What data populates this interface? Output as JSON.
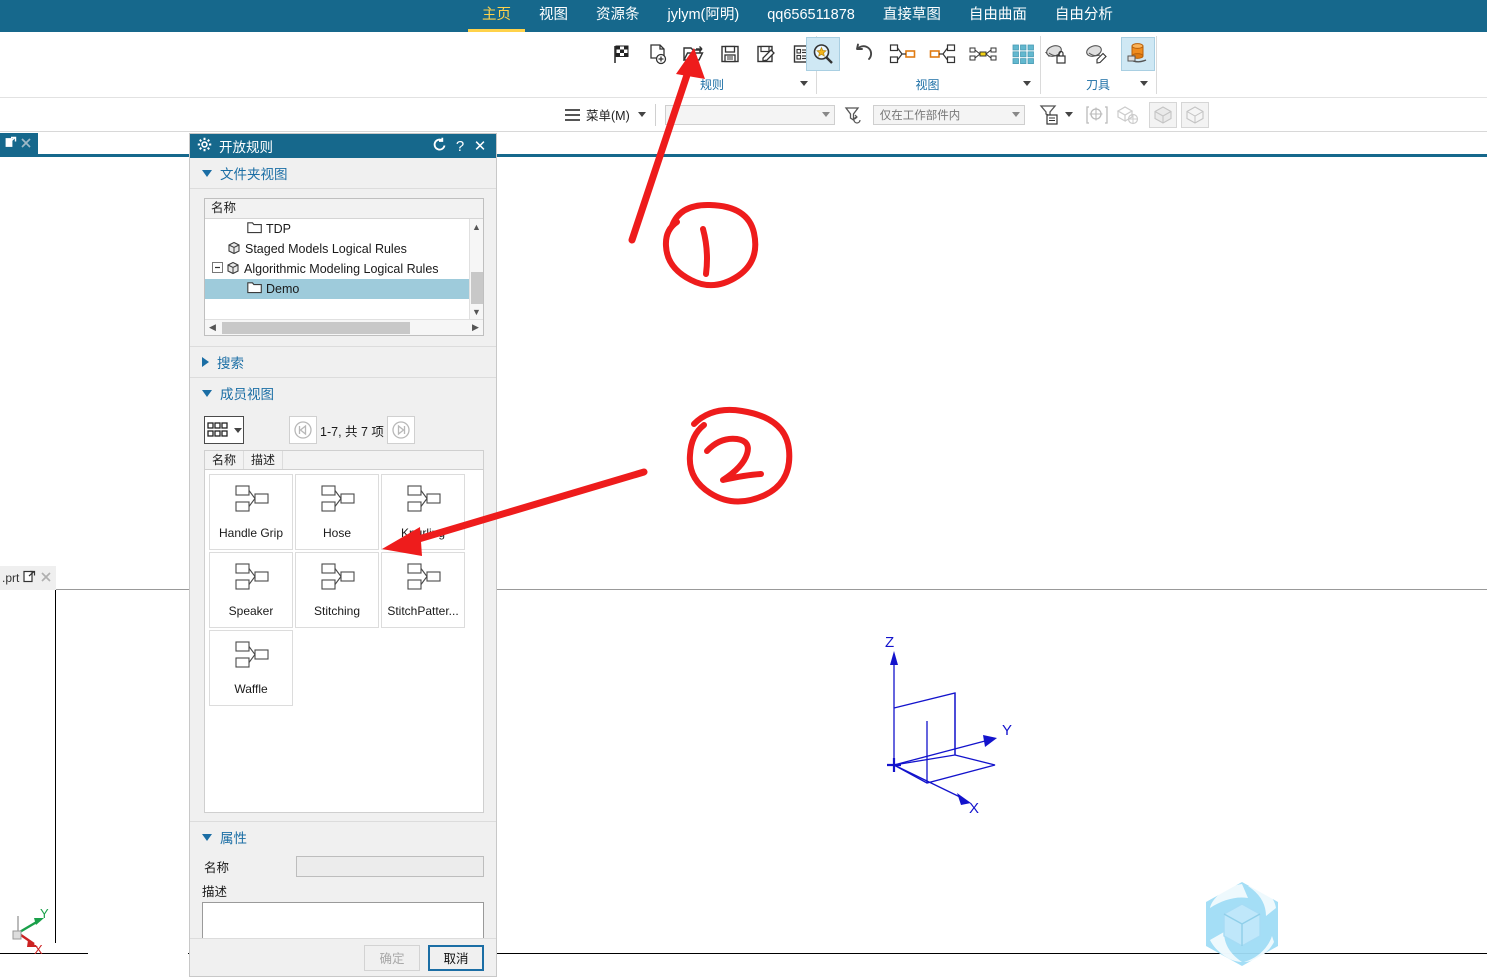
{
  "ribbon": {
    "tabs": [
      {
        "label": "主页",
        "active": true
      },
      {
        "label": "视图",
        "active": false
      },
      {
        "label": "资源条",
        "active": false
      },
      {
        "label": "jylym(阿明)",
        "active": false
      },
      {
        "label": "qq656511878",
        "active": false
      },
      {
        "label": "直接草图",
        "active": false
      },
      {
        "label": "自由曲面",
        "active": false
      },
      {
        "label": "自由分析",
        "active": false
      }
    ],
    "groups": [
      {
        "name": "规则",
        "icons": [
          "checkered-flag-icon",
          "new-document-icon",
          "open-folder-icon",
          "save-icon",
          "save-as-icon",
          "checklist-icon"
        ]
      },
      {
        "name": "视图",
        "icons": [
          "zoom-magnifier-icon",
          "undo-icon",
          "expand-node-icon",
          "collapse-node-icon",
          "link-nodes-icon",
          "grid-view-icon"
        ]
      },
      {
        "name": "刀具",
        "icons": [
          "tool-lock-icon",
          "tool-edit-icon",
          "tool-cylinder-icon"
        ]
      }
    ]
  },
  "toolbar2": {
    "menu_label": "菜单(M)",
    "combo1_value": "",
    "combo2_value": "仅在工作部件内",
    "icons": [
      "filter-undo-icon",
      "filter-list-icon",
      "selection-point-icon",
      "selection-body-icon",
      "shaded-view-icon",
      "wireframe-view-icon"
    ]
  },
  "dock": {
    "top_tab_icons": [
      "detach-icon",
      "close-icon"
    ],
    "lower_tab_label": ".prt",
    "lower_tab_icons": [
      "detach-icon",
      "close-icon"
    ]
  },
  "dialog": {
    "title": "开放规则",
    "title_icon": "gear-icon",
    "controls": [
      "refresh-icon",
      "help-icon",
      "close-icon"
    ],
    "folder_view": {
      "section_label": "文件夹视图",
      "column_header": "名称",
      "rows": [
        {
          "label": "TDP",
          "icon": "folder-icon",
          "depth": 2,
          "selected": false,
          "expander": ""
        },
        {
          "label": "Staged Models Logical Rules",
          "icon": "part-icon",
          "depth": 1,
          "selected": false,
          "expander": ""
        },
        {
          "label": "Algorithmic Modeling Logical Rules",
          "icon": "part-icon",
          "depth": 1,
          "selected": false,
          "expander": "-"
        },
        {
          "label": "Demo",
          "icon": "folder-icon",
          "depth": 2,
          "selected": true,
          "expander": ""
        }
      ]
    },
    "search": {
      "section_label": "搜索",
      "expanded": false
    },
    "member_view": {
      "section_label": "成员视图",
      "view_mode_icon": "grid-view-icon",
      "pager": {
        "prev_icon": "prev-page-icon",
        "next_icon": "next-page-icon",
        "text": "1-7, 共 7 项"
      },
      "columns": [
        "名称",
        "描述"
      ],
      "items": [
        {
          "name": "Handle Grip",
          "icon": "rule-node-icon"
        },
        {
          "name": "Hose",
          "icon": "rule-node-icon"
        },
        {
          "name": "Knurling",
          "icon": "rule-node-icon"
        },
        {
          "name": "Speaker",
          "icon": "rule-node-icon"
        },
        {
          "name": "Stitching",
          "icon": "rule-node-icon"
        },
        {
          "name": "StitchPatter...",
          "icon": "rule-node-icon"
        },
        {
          "name": "Waffle",
          "icon": "rule-node-icon"
        }
      ]
    },
    "properties": {
      "section_label": "属性",
      "name_label": "名称",
      "name_value": "",
      "desc_label": "描述",
      "desc_value": ""
    },
    "footer": {
      "ok_label": "确定",
      "cancel_label": "取消"
    }
  },
  "viewport": {
    "triad": {
      "x_label": "X",
      "y_label": "Y",
      "z_label": "Z",
      "color": "#1313cc"
    },
    "mini_axis": {
      "x_label": "X",
      "y_label": "Y"
    },
    "watermark_icon": "hexagon-cube-logo"
  },
  "annotations": [
    {
      "name": "marker-1",
      "label": "1",
      "target": "open-folder-icon"
    },
    {
      "name": "marker-2",
      "label": "2",
      "target": "member-view-items"
    }
  ],
  "colors": {
    "ribbon_bg": "#16688c",
    "active_tab": "#ffd24a",
    "section_label": "#1b6ea5",
    "tree_selection": "#9ecbdb",
    "annotation": "#ee1c1c"
  }
}
